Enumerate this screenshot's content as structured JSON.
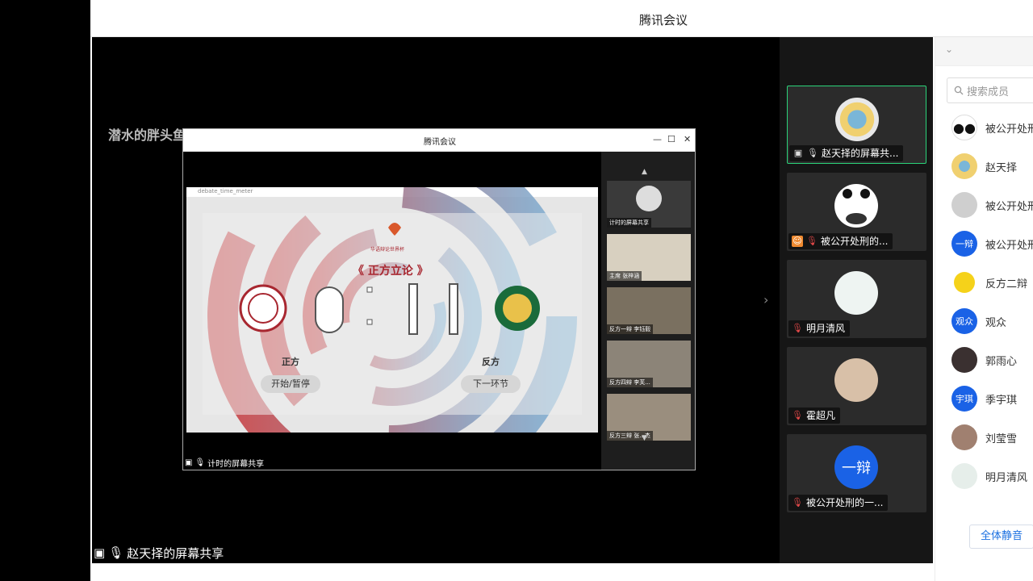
{
  "window": {
    "title": "腾讯会议"
  },
  "stage": {
    "watermark": "潜水的胖头鱼",
    "share_caption": "赵天择的屏幕共享",
    "inner": {
      "title": "腾讯会议",
      "app_title": "debate_time_meter",
      "event_logo": "华语辩论世界杯",
      "event_logo_en": "Chinese Debate World Cup",
      "phase": "《 正方立论 》",
      "timer": "0 : 1 1",
      "left_team": "正方",
      "right_team": "反方",
      "start_btn": "开始/暂停",
      "next_btn": "下一环节",
      "caption": "计时的屏幕共享",
      "tiles": [
        {
          "caption": "计时的屏幕共享"
        },
        {
          "caption": "主席 张梓涵"
        },
        {
          "caption": "反方一辩 李钰毅"
        },
        {
          "caption": "反方四辩 李芙..."
        },
        {
          "caption": "反方三辩 张...杰"
        }
      ]
    }
  },
  "strip": {
    "tiles": [
      {
        "name": "赵天择的屏幕共...",
        "icon": "screen-share-icon"
      },
      {
        "name": "被公开处刑的...",
        "icon": "host-icon"
      },
      {
        "name": "明月清风",
        "icon": "mic-muted-icon"
      },
      {
        "name": "霍超凡",
        "icon": "mic-muted-icon"
      },
      {
        "name": "被公开处刑的一...",
        "icon": "mic-muted-icon"
      }
    ]
  },
  "panel": {
    "search_placeholder": "搜索成员",
    "members": [
      {
        "name": "被公开处刑",
        "avatar": "panda"
      },
      {
        "name": "赵天择",
        "avatar": "sun"
      },
      {
        "name": "被公开处刑",
        "avatar": "photo"
      },
      {
        "name": "被公开处刑",
        "avatar": "一辩"
      },
      {
        "name": "反方二辩",
        "avatar": "emoji"
      },
      {
        "name": "观众",
        "avatar": "观众"
      },
      {
        "name": "郭雨心",
        "avatar": "photo-dark"
      },
      {
        "name": "季宇琪",
        "avatar": "宇琪"
      },
      {
        "name": "刘莹雪",
        "avatar": "photo-warm"
      },
      {
        "name": "明月清风",
        "avatar": "sketch"
      }
    ],
    "mute_all": "全体静音"
  },
  "colors": {
    "accent": "#1a6fe0",
    "active": "#2bd47a",
    "muted": "#e04848",
    "host": "#f08a30"
  }
}
